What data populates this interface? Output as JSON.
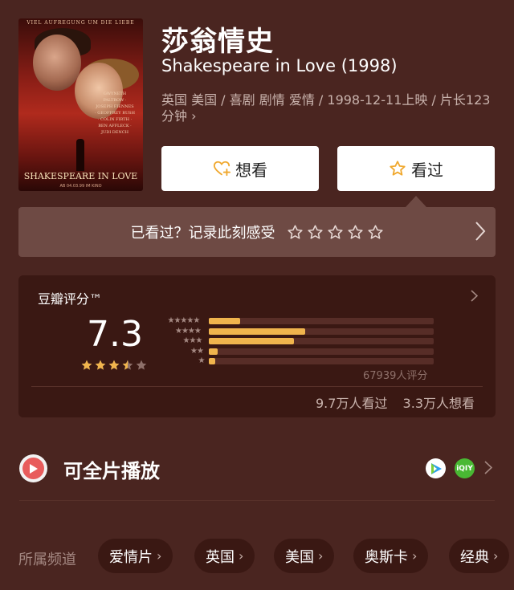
{
  "poster": {
    "top_text": "VIEL AUFREGUNG UM DIE LIEBE",
    "names": "GWYNETH PALTROW · JOSEPH FIENNES · GEOFFREY RUSH · COLIN FIRTH · BEN AFFLECK · JUDI DENCH",
    "title": "SHAKESPEARE IN LOVE",
    "bottom": "AB 04.03.99 IM KINO"
  },
  "movie": {
    "title_cn": "莎翁情史",
    "title_en": "Shakespeare in Love (1998)",
    "meta": "英国 美国 / 喜剧 剧情 爱情 / 1998-12-11上映 / 片长123分钟",
    "meta_chevron": "›"
  },
  "buttons": {
    "want_label": "想看",
    "seen_label": "看过"
  },
  "seen_prompt": {
    "label": "已看过？记录此刻感受"
  },
  "rating": {
    "header": "豆瓣评分™",
    "score": "7.3",
    "star_value": 3.5,
    "distribution": [
      {
        "stars": "★★★★★",
        "percent": 14
      },
      {
        "stars": "★★★★",
        "percent": 43
      },
      {
        "stars": "★★★",
        "percent": 38
      },
      {
        "stars": "★★",
        "percent": 4
      },
      {
        "stars": "★",
        "percent": 3
      }
    ],
    "count": "67939人评分",
    "watched": "9.7万人看过",
    "want": "3.3万人想看"
  },
  "play": {
    "label": "可全片播放",
    "source2": "iQIY"
  },
  "channels": {
    "label": "所属频道",
    "tags": [
      "爱情片",
      "英国",
      "美国",
      "奥斯卡",
      "经典"
    ]
  },
  "colors": {
    "background": "#4a2520",
    "accent_star": "#f0b44d",
    "card": "#3a1813"
  }
}
